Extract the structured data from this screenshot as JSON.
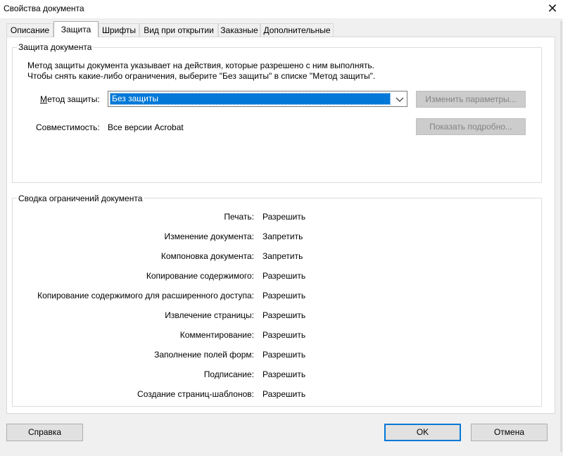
{
  "window": {
    "title": "Свойства документа",
    "close_glyph": "✕"
  },
  "tabs": [
    "Описание",
    "Защита",
    "Шрифты",
    "Вид при открытии",
    "Заказные",
    "Дополнительные"
  ],
  "security": {
    "group_title": "Защита документа",
    "description_line1": "Метод защиты документа указывает на действия, которые разрешено с ним выполнять.",
    "description_line2": "Чтобы снять какие-либо ограничения, выберите \"Без защиты\" в списке \"Метод защиты\".",
    "method_label_underlined": "М",
    "method_label_rest": "етод защиты:",
    "method_value": "Без защиты",
    "change_settings_button": "Изменить параметры...",
    "compat_label": "Совместимость:",
    "compat_value": "Все версии Acrobat",
    "show_details_button": "Показать подробно..."
  },
  "summary": {
    "group_title": "Сводка ограничений документа",
    "rows": [
      {
        "label": "Печать:",
        "value": "Разрешить"
      },
      {
        "label": "Изменение документа:",
        "value": "Запретить"
      },
      {
        "label": "Компоновка документа:",
        "value": "Запретить"
      },
      {
        "label": "Копирование содержимого:",
        "value": "Разрешить"
      },
      {
        "label": "Копирование содержимого для расширенного доступа:",
        "value": "Разрешить"
      },
      {
        "label": "Извлечение страницы:",
        "value": "Разрешить"
      },
      {
        "label": "Комментирование:",
        "value": "Разрешить"
      },
      {
        "label": "Заполнение полей форм:",
        "value": "Разрешить"
      },
      {
        "label": "Подписание:",
        "value": "Разрешить"
      },
      {
        "label": "Создание страниц-шаблонов:",
        "value": "Разрешить"
      }
    ]
  },
  "footer": {
    "help_button": "Справка",
    "ok_button": "OK",
    "cancel_button": "Отмена"
  },
  "colors": {
    "selection": "#0078d7",
    "default_button_border": "#0078d7"
  }
}
